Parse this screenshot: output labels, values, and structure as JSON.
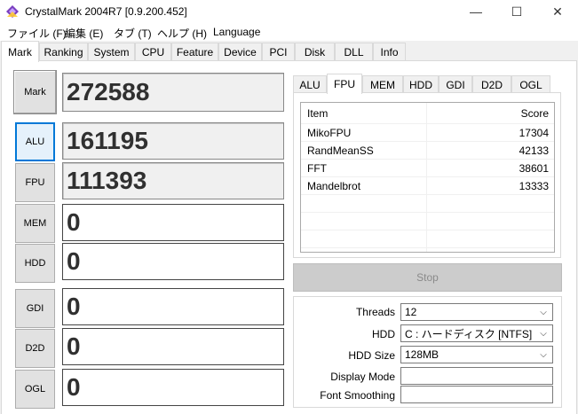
{
  "window": {
    "title": "CrystalMark 2004R7 [0.9.200.452]",
    "controls": {
      "minimize": "—",
      "maximize": "☐",
      "close": "✕"
    }
  },
  "menu": [
    "ファイル (F)",
    "編集 (E)",
    "タブ (T)",
    "ヘルプ (H)",
    "Language"
  ],
  "tabs": [
    "Mark",
    "Ranking",
    "System",
    "CPU",
    "Feature",
    "Device",
    "PCI",
    "Disk",
    "DLL",
    "Info"
  ],
  "active_tab": "Mark",
  "scores": {
    "mark": {
      "label": "Mark",
      "value": "272588"
    },
    "alu": {
      "label": "ALU",
      "value": "161195"
    },
    "fpu": {
      "label": "FPU",
      "value": "111393"
    },
    "mem": {
      "label": "MEM",
      "value": "0"
    },
    "hdd": {
      "label": "HDD",
      "value": "0"
    },
    "gdi": {
      "label": "GDI",
      "value": "0"
    },
    "d2d": {
      "label": "D2D",
      "value": "0"
    },
    "ogl": {
      "label": "OGL",
      "value": "0"
    }
  },
  "subtabs": [
    "ALU",
    "FPU",
    "MEM",
    "HDD",
    "GDI",
    "D2D",
    "OGL"
  ],
  "active_subtab": "FPU",
  "results": {
    "headers": {
      "item": "Item",
      "score": "Score"
    },
    "rows": [
      {
        "item": "MikoFPU",
        "score": "17304"
      },
      {
        "item": "RandMeanSS",
        "score": "42133"
      },
      {
        "item": "FFT",
        "score": "38601"
      },
      {
        "item": "Mandelbrot",
        "score": "13333"
      }
    ]
  },
  "stop_label": "Stop",
  "settings": {
    "threads": {
      "label": "Threads",
      "value": "12"
    },
    "hdd": {
      "label": "HDD",
      "value": "C : ハードディスク [NTFS]"
    },
    "hdd_size": {
      "label": "HDD Size",
      "value": "128MB"
    },
    "display_mode": {
      "label": "Display Mode",
      "value": ""
    },
    "font_smoothing": {
      "label": "Font Smoothing",
      "value": ""
    }
  },
  "icons": {
    "app": "crystalmark-app-icon",
    "dropdown": "chevron-down-icon"
  }
}
